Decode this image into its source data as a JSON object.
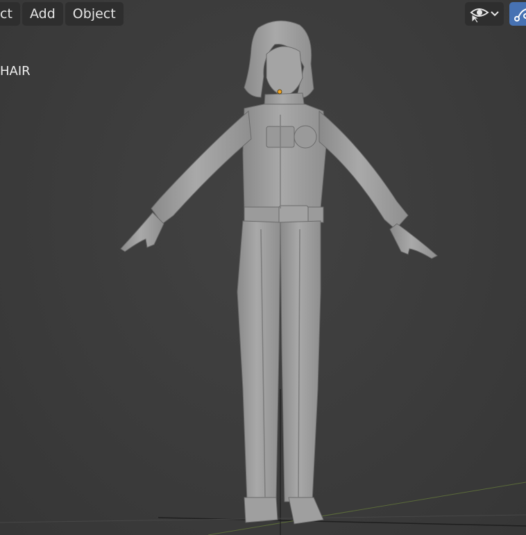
{
  "menubar": {
    "items": [
      {
        "label": "ct"
      },
      {
        "label": "Add"
      },
      {
        "label": "Object"
      }
    ]
  },
  "viewport": {
    "object_name": "HAIR"
  },
  "header_buttons": {
    "visibility_icon": "eye-selectable-icon",
    "dropdown_icon": "chevron-down-icon",
    "overlay_icon": "overlay-toggle-icon"
  },
  "colors": {
    "background": "#3d3d3d",
    "header_button": "#2e2e2e",
    "accent_active": "#4772b3",
    "x_axis": "#7a3a3a",
    "y_axis": "#5a7a3a",
    "origin_dot": "#f5a623"
  }
}
